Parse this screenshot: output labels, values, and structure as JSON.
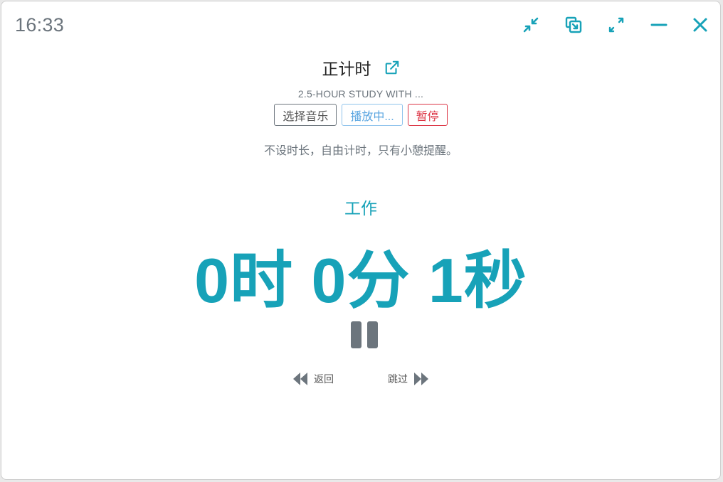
{
  "clock": "16:33",
  "window_controls": [
    {
      "name": "compress-icon"
    },
    {
      "name": "picture-in-picture-icon"
    },
    {
      "name": "expand-icon"
    },
    {
      "name": "minimize-icon"
    },
    {
      "name": "close-icon"
    }
  ],
  "title": "正计时",
  "music": {
    "name": "2.5-HOUR STUDY WITH ...",
    "select_label": "选择音乐",
    "playing_label": "播放中...",
    "pause_label": "暂停"
  },
  "description": "不设时长，自由计时，只有小憩提醒。",
  "phase": "工作",
  "timer": "0时 0分 1秒",
  "nav": {
    "back_label": "返回",
    "skip_label": "跳过"
  },
  "colors": {
    "accent": "#17a2b8",
    "muted": "#6c757d",
    "danger": "#dc3545",
    "playing": "#5aa5e0"
  }
}
